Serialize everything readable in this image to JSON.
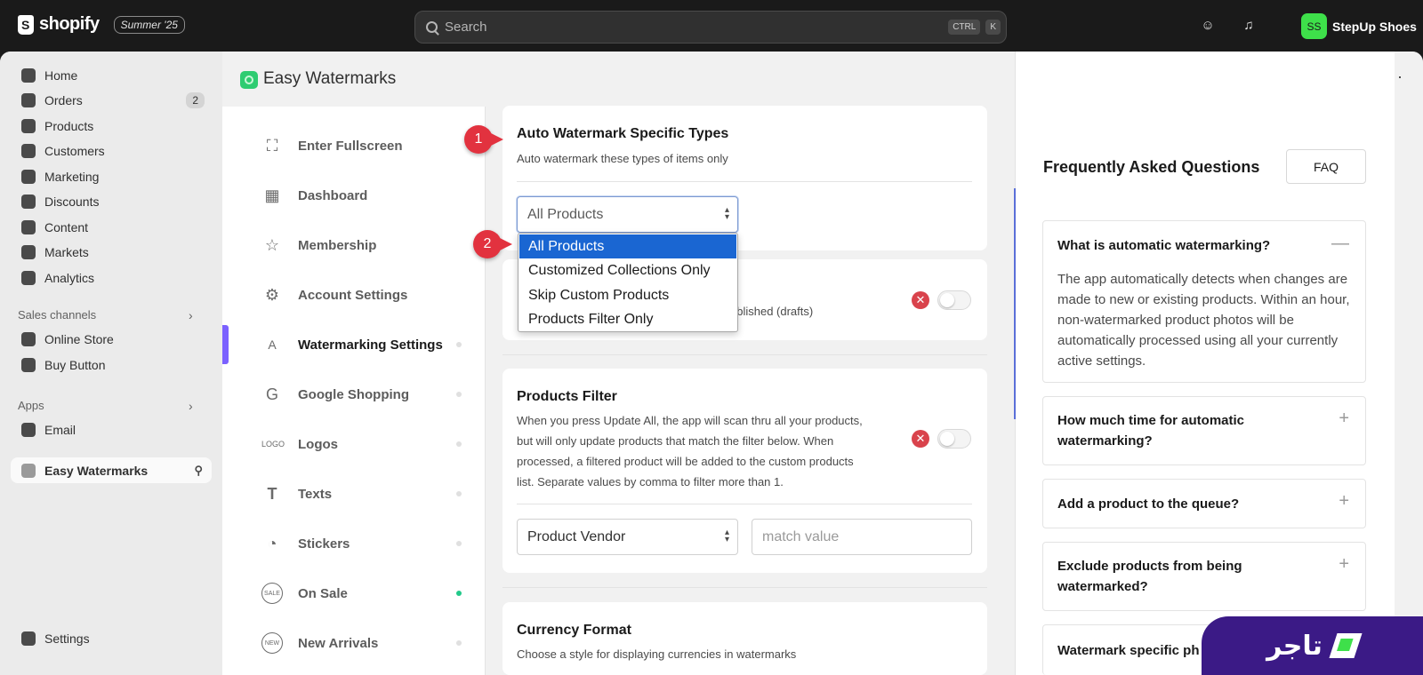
{
  "topbar": {
    "logo_text": "shopify",
    "edition": "Summer '25",
    "search_placeholder": "Search",
    "kbd1": "CTRL",
    "kbd2": "K",
    "store_initials": "SS",
    "store_name": "StepUp Shoes"
  },
  "nav": {
    "items": [
      {
        "label": "Home"
      },
      {
        "label": "Orders",
        "badge": "2"
      },
      {
        "label": "Products"
      },
      {
        "label": "Customers"
      },
      {
        "label": "Marketing"
      },
      {
        "label": "Discounts"
      },
      {
        "label": "Content"
      },
      {
        "label": "Markets"
      },
      {
        "label": "Analytics"
      }
    ],
    "sales_channels_label": "Sales channels",
    "sales_channels": [
      {
        "label": "Online Store"
      },
      {
        "label": "Buy Button"
      }
    ],
    "apps_label": "Apps",
    "apps": [
      {
        "label": "Email"
      }
    ],
    "pinned_app": "Easy Watermarks",
    "settings": "Settings"
  },
  "app": {
    "title": "Easy Watermarks",
    "menu": [
      {
        "label": "Enter Fullscreen",
        "icon": "⛶"
      },
      {
        "label": "Dashboard",
        "icon": "▦"
      },
      {
        "label": "Membership",
        "icon": "☆"
      },
      {
        "label": "Account Settings",
        "icon": "⚙"
      },
      {
        "label": "Watermarking Settings",
        "icon": "A"
      },
      {
        "label": "Google Shopping",
        "icon": "G"
      },
      {
        "label": "Logos",
        "icon": "LOGO"
      },
      {
        "label": "Texts",
        "icon": "T"
      },
      {
        "label": "Stickers",
        "icon": "◔"
      },
      {
        "label": "On Sale",
        "icon": "SALE"
      },
      {
        "label": "New Arrivals",
        "icon": "NEW"
      }
    ]
  },
  "auto_watermark": {
    "title": "Auto Watermark Specific Types",
    "subtitle": "Auto watermark these types of items only",
    "selected": "All Products",
    "options": [
      "All Products",
      "Customized Collections Only",
      "Skip Custom Products",
      "Products Filter Only"
    ],
    "hidden_text": "ublished (drafts)"
  },
  "products_filter": {
    "title": "Products Filter",
    "description": "When you press Update All, the app will scan thru all your products, but will only update products that match the filter below. When processed, a filtered product will be added to the custom products list. Separate values by comma to filter more than 1.",
    "select_value": "Product Vendor",
    "match_placeholder": "match value"
  },
  "currency": {
    "title": "Currency Format",
    "subtitle": "Choose a style for displaying currencies in watermarks"
  },
  "markers": [
    "1",
    "2"
  ],
  "faq": {
    "title": "Frequently Asked Questions",
    "button": "FAQ",
    "items": [
      {
        "q": "What is automatic watermarking?",
        "a": "The app automatically detects when changes are made to new or existing products. Within an hour, non-watermarked product photos will be automatically processed using all your currently active settings."
      },
      {
        "q": "How much time for automatic watermarking?"
      },
      {
        "q": "Add a product to the queue?"
      },
      {
        "q": "Exclude products from being watermarked?"
      },
      {
        "q": "Watermark specific ph"
      }
    ]
  },
  "brand": {
    "text": "تاجر"
  },
  "colors": {
    "accent": "#7b61ff",
    "selected_option": "#1a66d2",
    "marker": "#e2323f",
    "on_sale_dot": "#22c98a"
  }
}
